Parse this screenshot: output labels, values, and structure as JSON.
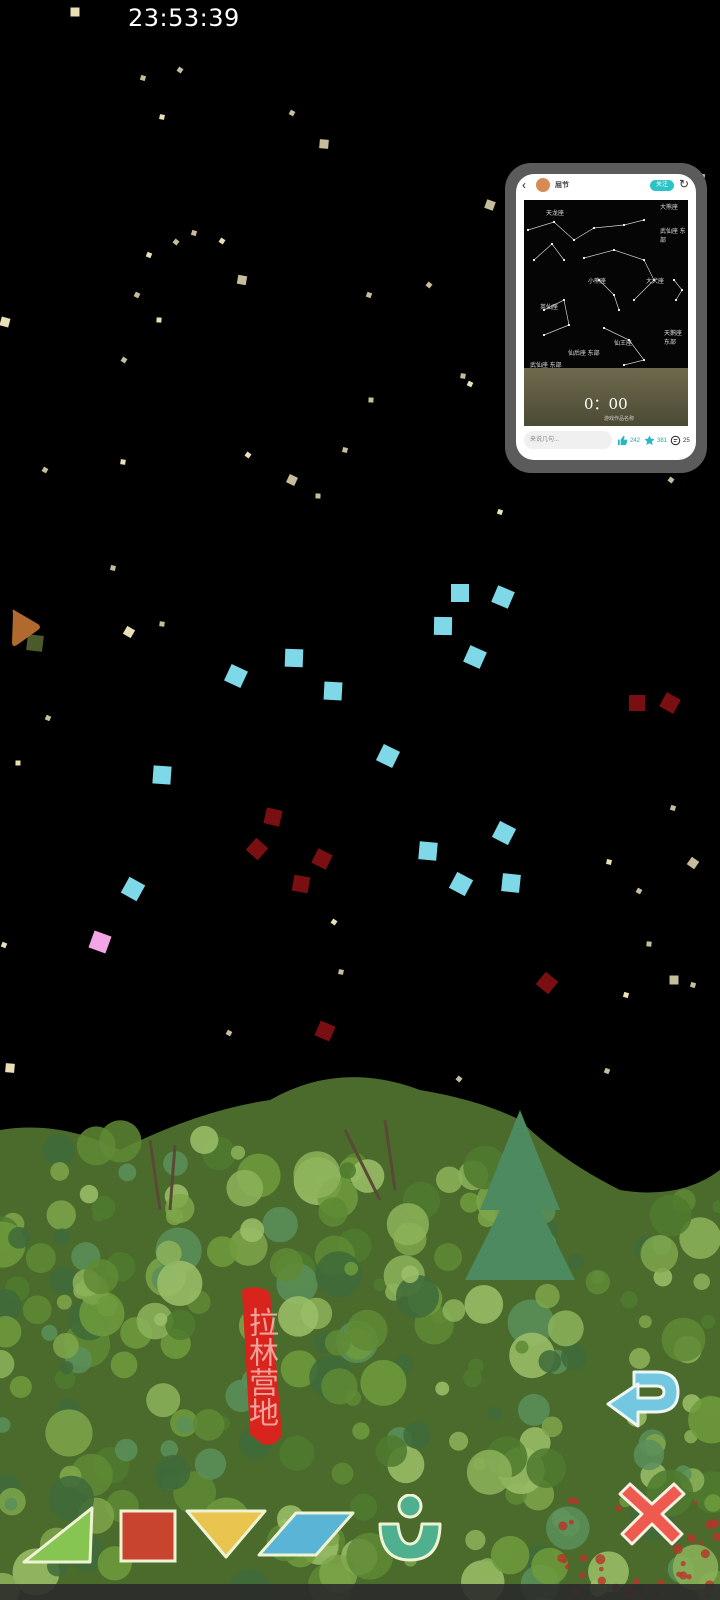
{
  "status_bar": {
    "time": "23:53:39"
  },
  "preview": {
    "username": "屈节",
    "follow_label": "关注",
    "timer": "0：00",
    "caption": "游戏作品名称",
    "comment_placeholder": "来说几句...",
    "likes": "242",
    "favorites": "381",
    "comments": "25",
    "constellations": [
      {
        "label": "天龙座"
      },
      {
        "label": "大熊座"
      },
      {
        "label": "武仙座 东部"
      },
      {
        "label": "小熊座"
      },
      {
        "label": "大犬座"
      },
      {
        "label": "英仙座"
      },
      {
        "label": "仙后座 东部"
      },
      {
        "label": "仙王座"
      },
      {
        "label": "天鹅座 东部"
      },
      {
        "label": "武仙座 东部"
      }
    ]
  },
  "seal_text": "拉林营地",
  "colors": {
    "background": "#000000",
    "cyan_piece": "#7fd8e8",
    "red_piece": "#7a0f12",
    "pink_piece": "#f2a6e6",
    "star": "#f6ecc2",
    "green_triangle": "#86c552",
    "red_square": "#c8442e",
    "yellow_triangle": "#e9c44e",
    "blue_parallelogram": "#5ab4d6",
    "green_figure": "#4eb08e",
    "undo_arrow": "#73c7e0",
    "close_x": "#ef5a4f"
  },
  "toolbar": {
    "icons": [
      "triangle-shape-icon",
      "square-shape-icon",
      "inverted-triangle-shape-icon",
      "parallelogram-shape-icon",
      "person-figure-icon"
    ]
  },
  "controls": {
    "undo_icon": "undo-arrow-icon",
    "close_icon": "close-x-icon",
    "side_arrow_icon": "play-arrow-icon"
  }
}
